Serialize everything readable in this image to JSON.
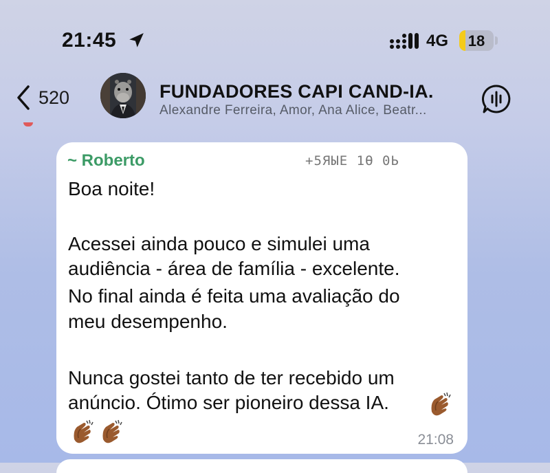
{
  "status_bar": {
    "time": "21:45",
    "network": "4G",
    "battery": "18",
    "battery_level": 0.18,
    "icons": [
      "location-arrow-icon",
      "signal-icon",
      "battery-icon"
    ]
  },
  "chat_header": {
    "back_count": "520",
    "group_name": "FUNDADORES CAPI CAND-IA.",
    "members": "Alexandre Ferreira, Amor, Ana Alice, Beatr...",
    "icons": [
      "chevron-left-icon",
      "group-avatar",
      "voice-chat-icon"
    ]
  },
  "message": {
    "sender": "~ Roberto",
    "phone": "+5ЯЫЕ 1Ѳ 0Ь",
    "lines": [
      "Boa noite!",
      "",
      "Acessei ainda pouco e simulei uma",
      "audiência - área de família - excelente.",
      "No final ainda é feita uma avaliação do",
      "meu desempenho.",
      "",
      "Nunca gostei tanto de ter recebido um",
      "anúncio. Ótimo ser pioneiro dessa IA."
    ],
    "emoji": "clapping-hands-icon",
    "time": "21:08"
  },
  "colors": {
    "sender": "#3c9b66",
    "bubble": "#ffffff",
    "battery": "#f4cb1a"
  }
}
